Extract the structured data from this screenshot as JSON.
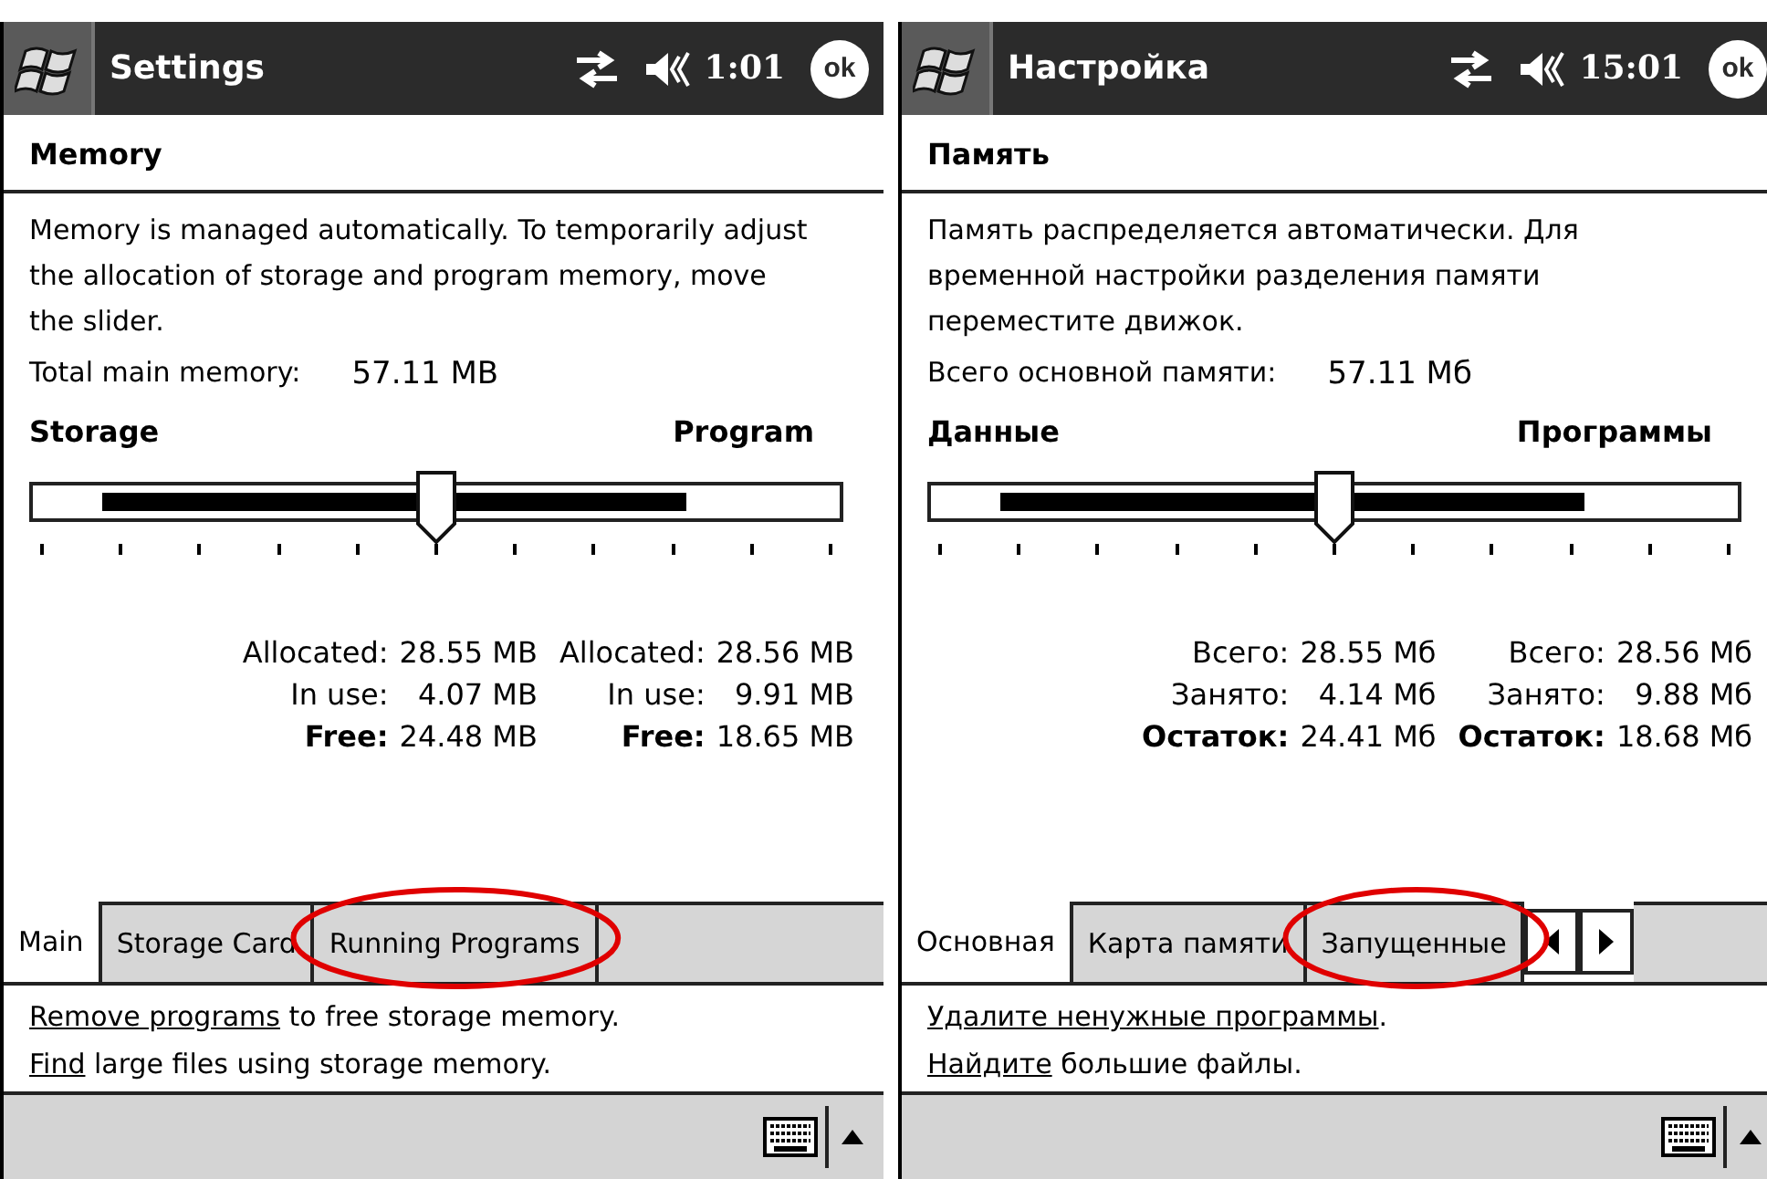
{
  "screens": [
    {
      "title": "Settings",
      "time": "1:01",
      "ok": "ok",
      "heading": "Memory",
      "description": "Memory is managed automatically. To temporarily adjust the allocation of storage and program memory, move the slider.",
      "total_label": "Total main memory:",
      "total_value": "57.11 MB",
      "left_label": "Storage",
      "right_label": "Program",
      "slider": {
        "level": 0.5
      },
      "stats": [
        [
          {
            "label": "Allocated:",
            "value": "28.55 MB",
            "bold": false
          },
          {
            "label": "In use:",
            "value": "4.07 MB",
            "bold": false
          },
          {
            "label": "Free:",
            "value": "24.48 MB",
            "bold": true
          }
        ],
        [
          {
            "label": "Allocated:",
            "value": "28.56 MB",
            "bold": false
          },
          {
            "label": "In use:",
            "value": "9.91 MB",
            "bold": false
          },
          {
            "label": "Free:",
            "value": "18.65 MB",
            "bold": true
          }
        ]
      ],
      "tabs": [
        {
          "label": "Main",
          "selected": true,
          "circled": false
        },
        {
          "label": "Storage Card",
          "selected": false,
          "circled": false
        },
        {
          "label": "Running Programs",
          "selected": false,
          "circled": true
        }
      ],
      "tab_arrows": false,
      "links": [
        {
          "link": "Remove programs",
          "rest": " to free storage memory."
        },
        {
          "link": "Find",
          "rest": " large files using storage memory."
        }
      ]
    },
    {
      "title": "Настройка",
      "time": "15:01",
      "ok": "ok",
      "heading": "Память",
      "description": "Память распределяется автоматически. Для временной настройки разделения памяти переместите движок.",
      "total_label": "Всего основной памяти:",
      "total_value": "57.11 Мб",
      "left_label": "Данные",
      "right_label": "Программы",
      "slider": {
        "level": 0.5
      },
      "stats": [
        [
          {
            "label": "Всего:",
            "value": "28.55 Мб",
            "bold": false
          },
          {
            "label": "Занято:",
            "value": "4.14 Мб",
            "bold": false
          },
          {
            "label": "Остаток:",
            "value": "24.41 Мб",
            "bold": true
          }
        ],
        [
          {
            "label": "Всего:",
            "value": "28.56 Мб",
            "bold": false
          },
          {
            "label": "Занято:",
            "value": "9.88 Мб",
            "bold": false
          },
          {
            "label": "Остаток:",
            "value": "18.68 Мб",
            "bold": true
          }
        ]
      ],
      "tabs": [
        {
          "label": "Основная",
          "selected": true,
          "circled": false
        },
        {
          "label": "Карта памяти",
          "selected": false,
          "circled": false
        },
        {
          "label": "Запущенные",
          "selected": false,
          "circled": true
        }
      ],
      "tab_arrows": true,
      "links": [
        {
          "link": "Удалите ненужные программы",
          "rest": "."
        },
        {
          "link": "Найдите",
          "rest": " большие файлы."
        }
      ]
    }
  ]
}
